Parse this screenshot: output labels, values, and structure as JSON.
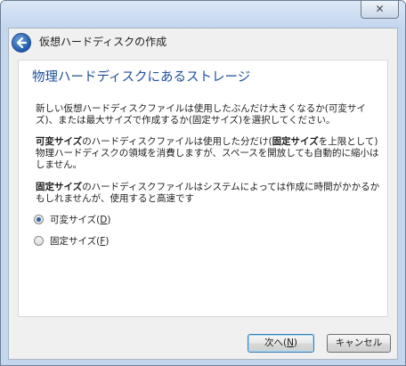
{
  "window": {
    "close_glyph": "✕"
  },
  "header": {
    "title": "仮想ハードディスクの作成"
  },
  "main": {
    "page_title": "物理ハードディスクにあるストレージ",
    "intro": "新しい仮想ハードディスクファイルは使用したぶんだけ大きくなるか(可変サイズ)、または最大サイズで作成するか(固定サイズ)を選択してください。",
    "dynamic_term": "可変サイズ",
    "dynamic_mid": "のハードディスクファイルは使用した分だけ(",
    "dynamic_term2": "固定サイズ",
    "dynamic_rest": "を上限として)物理ハードディスクの領域を消費しますが、スペースを開放しても自動的に縮小はしません。",
    "fixed_term": "固定サイズ",
    "fixed_rest": "のハードディスクファイルはシステムによっては作成に時間がかかるかもしれませんが、使用すると高速です",
    "options": [
      {
        "label": "可変サイズ(",
        "mnemonic": "D",
        "suffix": ")",
        "selected": true
      },
      {
        "label": "固定サイズ(",
        "mnemonic": "F",
        "suffix": ")",
        "selected": false
      }
    ]
  },
  "buttons": {
    "next": {
      "label": "次へ(",
      "mnemonic": "N",
      "suffix": ")"
    },
    "cancel": {
      "label": "キャンセル"
    }
  },
  "colors": {
    "title_blue": "#1e4f9a",
    "frame": "#c3d6ec"
  },
  "icons": {
    "back": "back-arrow-icon",
    "radio_selected": "radio-selected-icon"
  }
}
